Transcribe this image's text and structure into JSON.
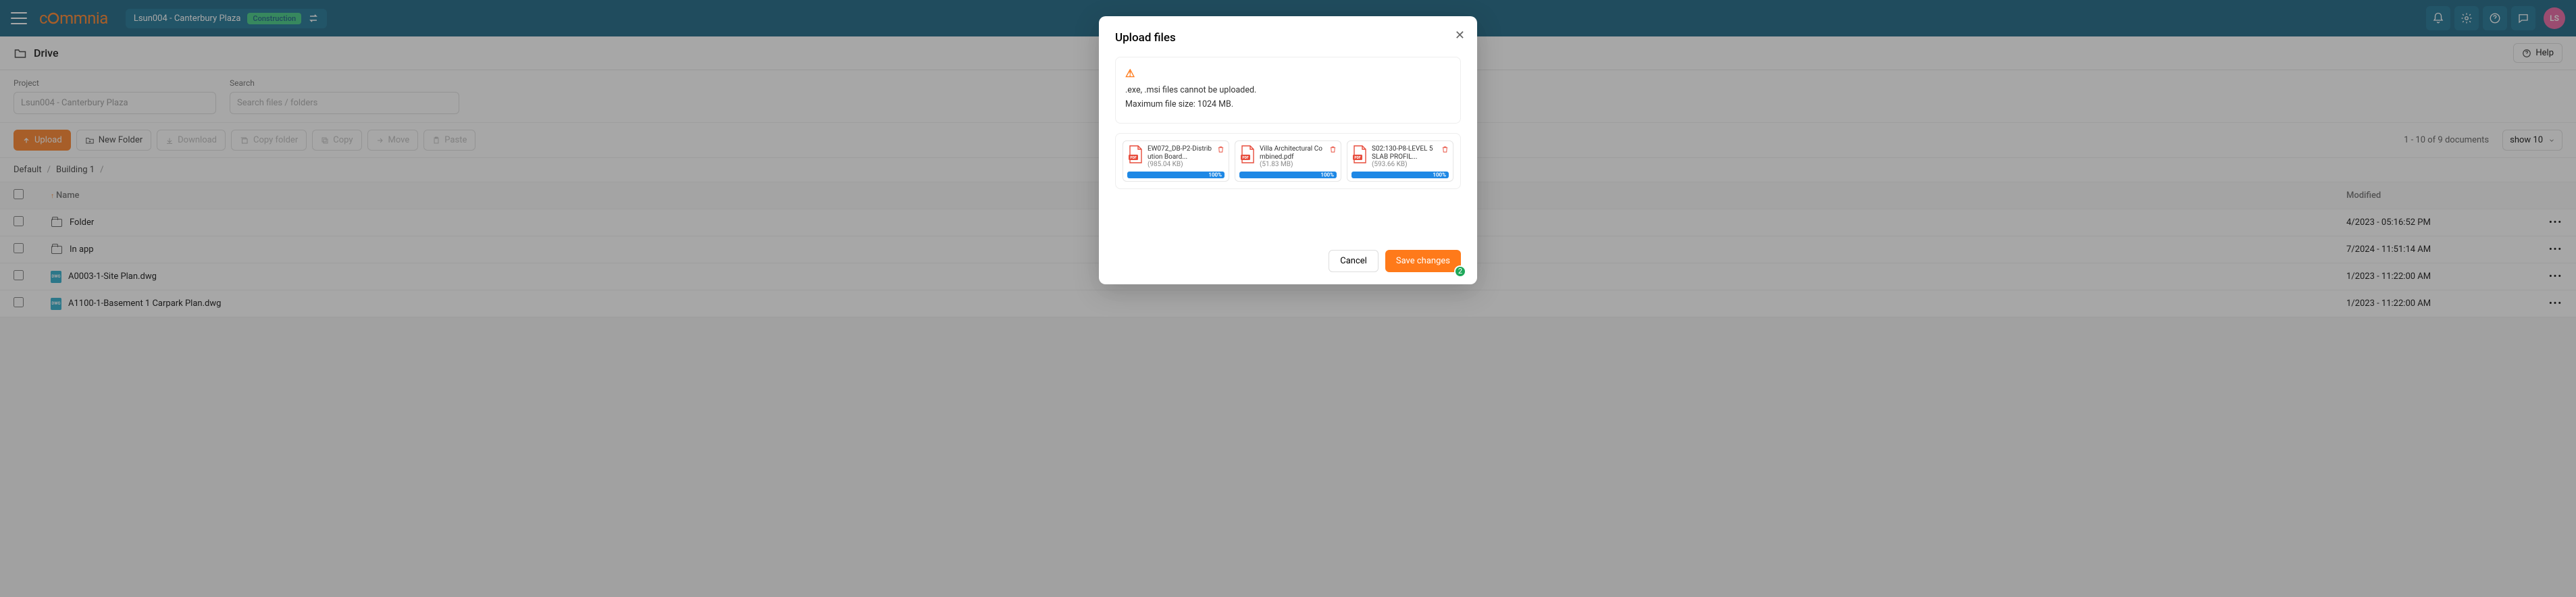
{
  "header": {
    "project_label": "Lsun004 - Canterbury Plaza",
    "project_tag": "Construction",
    "avatar_initials": "LS"
  },
  "drive_bar": {
    "title": "Drive",
    "help_label": "Help"
  },
  "filters": {
    "project_label": "Project",
    "project_value": "Lsun004 - Canterbury Plaza",
    "search_label": "Search",
    "search_placeholder": "Search files / folders"
  },
  "toolbar": {
    "upload": "Upload",
    "new_folder": "New Folder",
    "download": "Download",
    "copy_folder": "Copy folder",
    "copy": "Copy",
    "move": "Move",
    "paste": "Paste",
    "pager": "1 - 10 of 9 documents",
    "show_label": "show 10"
  },
  "breadcrumb": {
    "root": "Default",
    "folder": "Building 1"
  },
  "table": {
    "col_name": "Name",
    "col_modified": "Modified",
    "rows": [
      {
        "type": "folder",
        "name": "Folder",
        "modified": "4/2023 - 05:16:52 PM"
      },
      {
        "type": "folder",
        "name": "In app",
        "modified": "7/2024 - 11:51:14 AM"
      },
      {
        "type": "dwg",
        "name": "A0003-1-Site Plan.dwg",
        "modified": "1/2023 - 11:22:00 AM"
      },
      {
        "type": "dwg",
        "name": "A1100-1-Basement 1 Carpark Plan.dwg",
        "modified": "1/2023 - 11:22:00 AM"
      }
    ]
  },
  "modal": {
    "title": "Upload files",
    "warning_line1": ".exe, .msi files cannot be uploaded.",
    "warning_line2": "Maximum file size: 1024 MB.",
    "files": [
      {
        "name": "EW072_DB-P2-Distribution Board...",
        "size": "(985.04 KB)",
        "progress": "100%"
      },
      {
        "name": "Villa Architectural Combined.pdf",
        "size": "(51.83 MB)",
        "progress": "100%"
      },
      {
        "name": "S02:130-P8-LEVEL 5 SLAB PROFIL...",
        "size": "(593.66 KB)",
        "progress": "100%"
      }
    ],
    "cancel": "Cancel",
    "save": "Save changes",
    "badge": "2"
  }
}
